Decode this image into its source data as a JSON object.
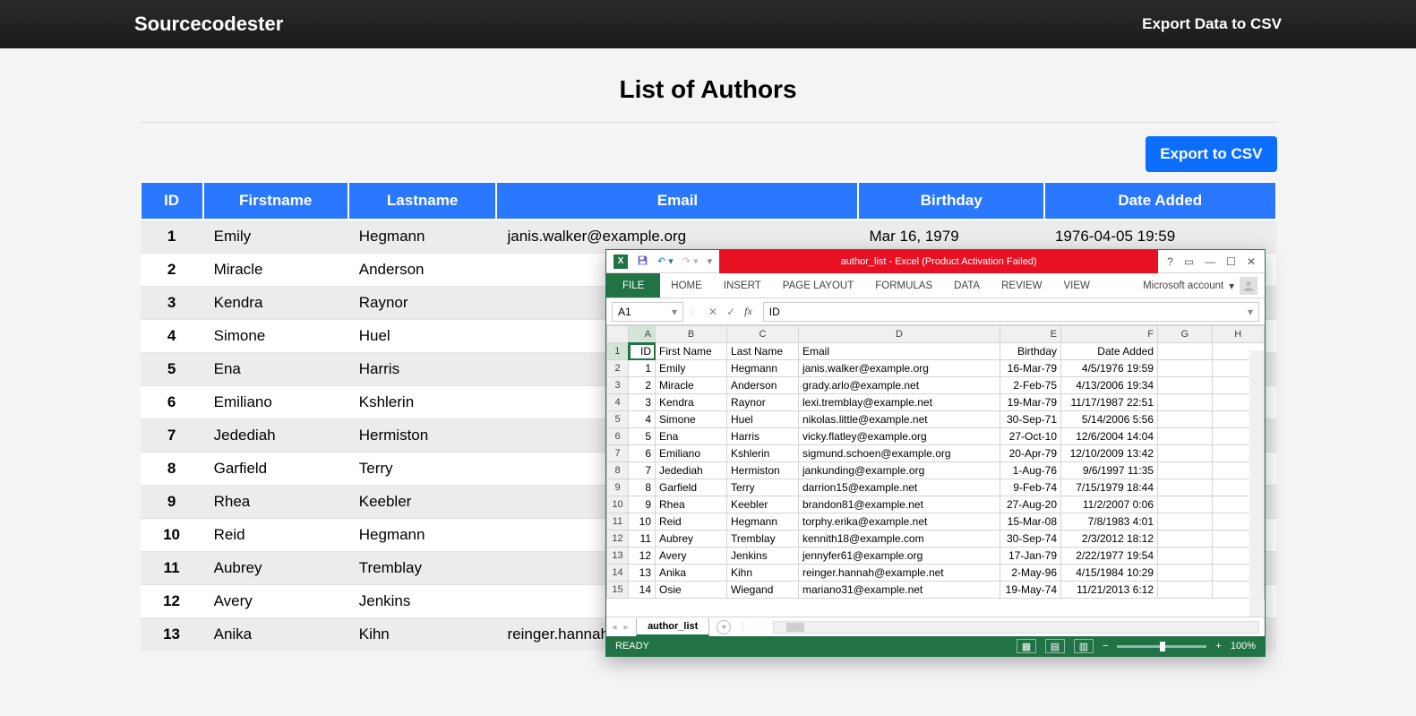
{
  "navbar": {
    "brand": "Sourcecodester",
    "link": "Export Data to CSV"
  },
  "page": {
    "title": "List of Authors",
    "export_button": "Export to CSV"
  },
  "columns": [
    "ID",
    "Firstname",
    "Lastname",
    "Email",
    "Birthday",
    "Date Added"
  ],
  "rows": [
    {
      "id": "1",
      "firstname": "Emily",
      "lastname": "Hegmann",
      "email": "janis.walker@example.org",
      "birthday": "Mar 16, 1979",
      "date_added": "1976-04-05 19:59"
    },
    {
      "id": "2",
      "firstname": "Miracle",
      "lastname": "Anderson",
      "email": "",
      "birthday": "",
      "date_added": ""
    },
    {
      "id": "3",
      "firstname": "Kendra",
      "lastname": "Raynor",
      "email": "",
      "birthday": "",
      "date_added": ""
    },
    {
      "id": "4",
      "firstname": "Simone",
      "lastname": "Huel",
      "email": "",
      "birthday": "",
      "date_added": ""
    },
    {
      "id": "5",
      "firstname": "Ena",
      "lastname": "Harris",
      "email": "",
      "birthday": "",
      "date_added": ""
    },
    {
      "id": "6",
      "firstname": "Emiliano",
      "lastname": "Kshlerin",
      "email": "",
      "birthday": "",
      "date_added": ""
    },
    {
      "id": "7",
      "firstname": "Jedediah",
      "lastname": "Hermiston",
      "email": "",
      "birthday": "",
      "date_added": ""
    },
    {
      "id": "8",
      "firstname": "Garfield",
      "lastname": "Terry",
      "email": "",
      "birthday": "",
      "date_added": ""
    },
    {
      "id": "9",
      "firstname": "Rhea",
      "lastname": "Keebler",
      "email": "",
      "birthday": "",
      "date_added": ""
    },
    {
      "id": "10",
      "firstname": "Reid",
      "lastname": "Hegmann",
      "email": "",
      "birthday": "",
      "date_added": ""
    },
    {
      "id": "11",
      "firstname": "Aubrey",
      "lastname": "Tremblay",
      "email": "",
      "birthday": "",
      "date_added": ""
    },
    {
      "id": "12",
      "firstname": "Avery",
      "lastname": "Jenkins",
      "email": "",
      "birthday": "",
      "date_added": ""
    },
    {
      "id": "13",
      "firstname": "Anika",
      "lastname": "Kihn",
      "email": "reinger.hannah@example.net",
      "birthday": "May 02, 1996",
      "date_added": "1984-04-15 10:29"
    }
  ],
  "excel": {
    "title": "author_list -  Excel (Product Activation Failed)",
    "tabs": {
      "file": "FILE",
      "home": "HOME",
      "insert": "INSERT",
      "page_layout": "PAGE LAYOUT",
      "formulas": "FORMULAS",
      "data": "DATA",
      "review": "REVIEW",
      "view": "VIEW"
    },
    "account_label": "Microsoft account",
    "namebox": "A1",
    "formula_value": "ID",
    "col_letters": [
      "A",
      "B",
      "C",
      "D",
      "E",
      "F",
      "G",
      "H"
    ],
    "header_row": [
      "ID",
      "First Name",
      "Last Name",
      "Email",
      "Birthday",
      "Date Added"
    ],
    "rows": [
      [
        "1",
        "Emily",
        "Hegmann",
        "janis.walker@example.org",
        "16-Mar-79",
        "4/5/1976 19:59"
      ],
      [
        "2",
        "Miracle",
        "Anderson",
        "grady.arlo@example.net",
        "2-Feb-75",
        "4/13/2006 19:34"
      ],
      [
        "3",
        "Kendra",
        "Raynor",
        "lexi.tremblay@example.net",
        "19-Mar-79",
        "11/17/1987 22:51"
      ],
      [
        "4",
        "Simone",
        "Huel",
        "nikolas.little@example.net",
        "30-Sep-71",
        "5/14/2006 5:56"
      ],
      [
        "5",
        "Ena",
        "Harris",
        "vicky.flatley@example.org",
        "27-Oct-10",
        "12/6/2004 14:04"
      ],
      [
        "6",
        "Emiliano",
        "Kshlerin",
        "sigmund.schoen@example.org",
        "20-Apr-79",
        "12/10/2009 13:42"
      ],
      [
        "7",
        "Jedediah",
        "Hermiston",
        "jankunding@example.org",
        "1-Aug-76",
        "9/6/1997 11:35"
      ],
      [
        "8",
        "Garfield",
        "Terry",
        "darrion15@example.net",
        "9-Feb-74",
        "7/15/1979 18:44"
      ],
      [
        "9",
        "Rhea",
        "Keebler",
        "brandon81@example.net",
        "27-Aug-20",
        "11/2/2007 0:06"
      ],
      [
        "10",
        "Reid",
        "Hegmann",
        "torphy.erika@example.net",
        "15-Mar-08",
        "7/8/1983 4:01"
      ],
      [
        "11",
        "Aubrey",
        "Tremblay",
        "kennith18@example.com",
        "30-Sep-74",
        "2/3/2012 18:12"
      ],
      [
        "12",
        "Avery",
        "Jenkins",
        "jennyfer61@example.org",
        "17-Jan-79",
        "2/22/1977 19:54"
      ],
      [
        "13",
        "Anika",
        "Kihn",
        "reinger.hannah@example.net",
        "2-May-96",
        "4/15/1984 10:29"
      ],
      [
        "14",
        "Osie",
        "Wiegand",
        "mariano31@example.net",
        "19-May-74",
        "11/21/2013 6:12"
      ]
    ],
    "sheet_name": "author_list",
    "status_ready": "READY",
    "zoom": "100%"
  }
}
